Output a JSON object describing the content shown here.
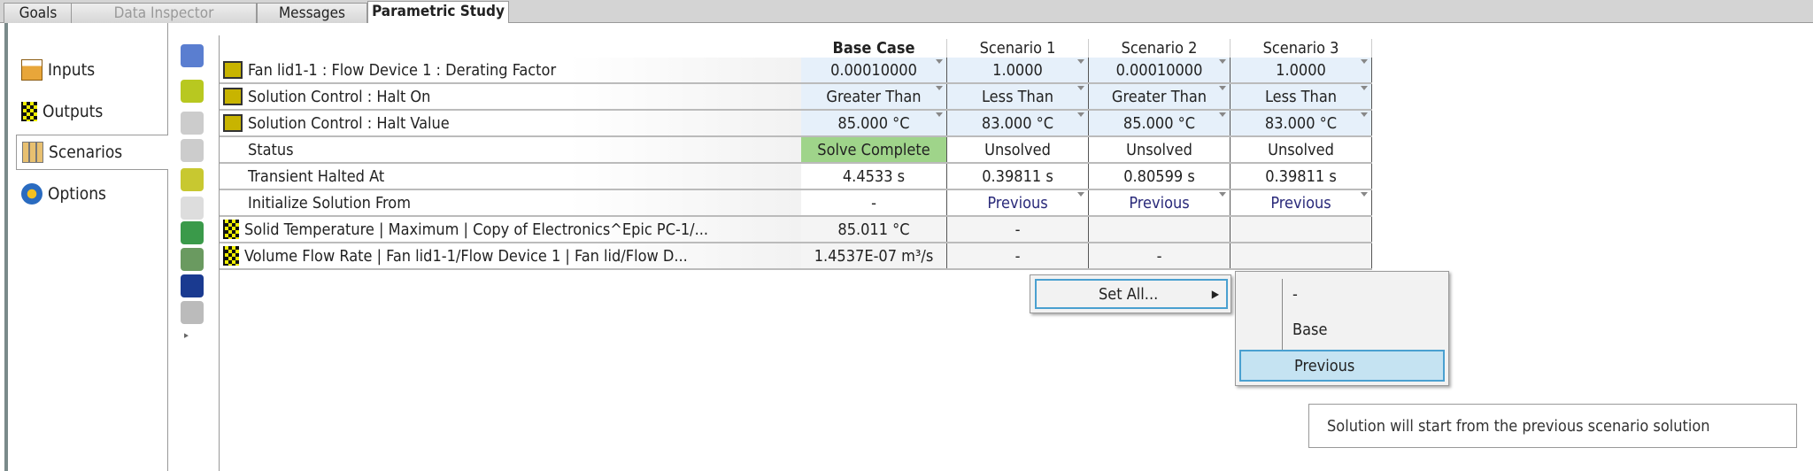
{
  "tabs": [
    {
      "label": "Goals"
    },
    {
      "label": "Data Inspector"
    },
    {
      "label": "Messages"
    },
    {
      "label": "Parametric Study"
    }
  ],
  "nav": [
    {
      "label": "Inputs"
    },
    {
      "label": "Outputs"
    },
    {
      "label": "Scenarios"
    },
    {
      "label": "Options"
    }
  ],
  "columns": [
    "Base Case",
    "Scenario 1",
    "Scenario 2",
    "Scenario 3"
  ],
  "rows": [
    {
      "label": "Fan lid1-1 : Flow Device 1 : Derating Factor",
      "values": [
        "0.00010000",
        "1.0000",
        "0.00010000",
        "1.0000"
      ]
    },
    {
      "label": "Solution Control : Halt On",
      "values": [
        "Greater Than",
        "Less Than",
        "Greater Than",
        "Less Than"
      ]
    },
    {
      "label": "Solution Control : Halt Value",
      "values": [
        "85.000 °C",
        "83.000 °C",
        "85.000 °C",
        "83.000 °C"
      ]
    },
    {
      "label": "Status",
      "values": [
        "Solve Complete",
        "Unsolved",
        "Unsolved",
        "Unsolved"
      ]
    },
    {
      "label": "Transient Halted At",
      "values": [
        "4.4533 s",
        "0.39811 s",
        "0.80599 s",
        "0.39811 s"
      ]
    },
    {
      "label": "Initialize Solution From",
      "values": [
        "-",
        "Previous",
        "Previous",
        "Previous"
      ]
    },
    {
      "label": "Solid Temperature | Maximum | Copy of Electronics^Epic PC-1/...",
      "values": [
        "85.011 °C",
        "-",
        "",
        ""
      ]
    },
    {
      "label": "Volume Flow Rate | Fan lid1-1/Flow Device 1 | Fan lid/Flow D...",
      "values": [
        "1.4537E-07 m³/s",
        "-",
        "-",
        ""
      ]
    }
  ],
  "context_menu": {
    "set_all": "Set All..."
  },
  "submenu": [
    "-",
    "Base",
    "Previous"
  ],
  "tooltip": "Solution will start from the previous scenario solution",
  "colors": {
    "selected": "#c5e3f2",
    "status_complete": "#9fd48a"
  }
}
